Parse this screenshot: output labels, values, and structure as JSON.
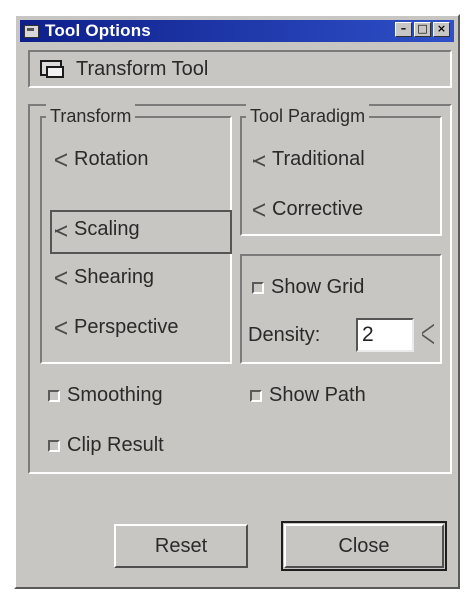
{
  "window": {
    "title": "Tool Options",
    "title_buttons": [
      "–",
      "□",
      "×"
    ]
  },
  "tool": {
    "name": "Transform Tool",
    "icon": "transform-tool-icon"
  },
  "transform_group": {
    "label": "Transform",
    "options": [
      "Rotation",
      "Scaling",
      "Shearing",
      "Perspective"
    ],
    "selected": "Scaling"
  },
  "paradigm_group": {
    "label": "Tool Paradigm",
    "options": [
      "Traditional",
      "Corrective"
    ],
    "selected": "Traditional"
  },
  "grid": {
    "show_grid_label": "Show Grid",
    "density_label": "Density:",
    "density_value": "2"
  },
  "checks": {
    "smoothing_label": "Smoothing",
    "show_path_label": "Show Path",
    "clip_result_label": "Clip Result"
  },
  "buttons": {
    "reset_label": "Reset",
    "close_label": "Close"
  }
}
